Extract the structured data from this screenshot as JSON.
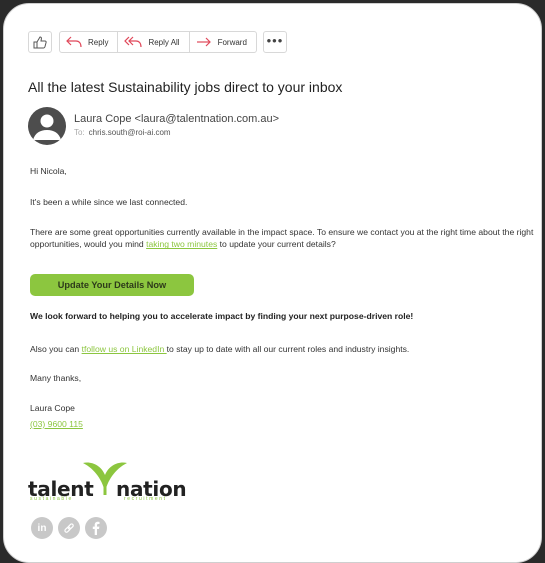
{
  "toolbar": {
    "reply_label": "Reply",
    "reply_all_label": "Reply All",
    "forward_label": "Forward",
    "more_label": "•••"
  },
  "email": {
    "subject": "All the latest Sustainability jobs direct to your inbox",
    "from": "Laura Cope <laura@talentnation.com.au>",
    "to_label": "To:",
    "to": "chris.south@roi-ai.com"
  },
  "body": {
    "greeting": "Hi Nicola,",
    "p1": "It's been a while since we last connected.",
    "p2_before": "There are some great opportunities currently available in the impact space. To ensure we contact you at the right time about the right opportunities, would you mind ",
    "p2_link": "taking two minutes",
    "p2_after": " to update your current details?",
    "cta_label": "Update Your Details Now",
    "p3": "We look forward to helping you to accelerate impact by finding your next purpose-driven role!",
    "p4_before": "Also you can ",
    "p4_link": "tfollow us on LinkedIn ",
    "p4_after": "to stay up to date with all our current roles and industry insights.",
    "signoff": "Many thanks,",
    "sig_name": "Laura Cope",
    "sig_phone": "(03) 9600 115"
  },
  "logo": {
    "word_left": "talent",
    "word_right": "nation",
    "tagline_left": "sustainable",
    "tagline_right": "recruitment"
  },
  "socials": {
    "linkedin": "in"
  },
  "colors": {
    "accent": "#8cc63f",
    "reply_arrow": "#e0485a"
  }
}
